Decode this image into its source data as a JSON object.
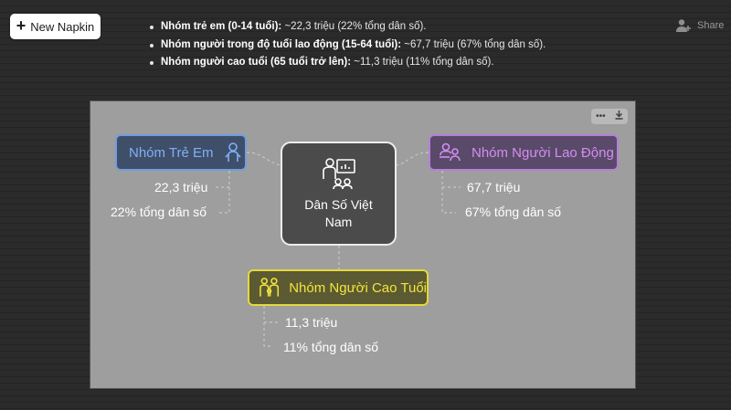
{
  "toolbar": {
    "new_label": "New Napkin",
    "share_label": "Share"
  },
  "bullets": [
    {
      "bold": "Nhóm trẻ em (0-14 tuổi):",
      "text": " ~22,3 triệu (22% tổng dân số)."
    },
    {
      "bold": "Nhóm người trong độ tuổi lao động (15-64 tuổi):",
      "text": " ~67,7 triệu (67% tổng dân số)."
    },
    {
      "bold": "Nhóm người cao tuổi (65 tuổi trở lên):",
      "text": " ~11,3 triệu (11% tổng dân số)."
    }
  ],
  "canvas": {
    "tools": [
      "more-icon",
      "download-icon"
    ]
  },
  "diagram": {
    "center": {
      "title": "Dân Số Việt Nam",
      "icon": "presentation-people-icon"
    },
    "children": {
      "label": "Nhóm Trẻ Em",
      "icon": "child-icon",
      "color": "#7fb0f5",
      "count": "22,3 triệu",
      "share": "22% tổng dân số"
    },
    "working": {
      "label": "Nhóm Người Lao Động",
      "icon": "worker-at-desk-icon",
      "color": "#d38ef0",
      "count": "67,7 triệu",
      "share": "67% tổng dân số"
    },
    "elderly": {
      "label": "Nhóm Người Cao Tuổi",
      "icon": "family-icon",
      "color": "#f1e53c",
      "count": "11,3 triệu",
      "share": "11% tổng dân số"
    }
  }
}
